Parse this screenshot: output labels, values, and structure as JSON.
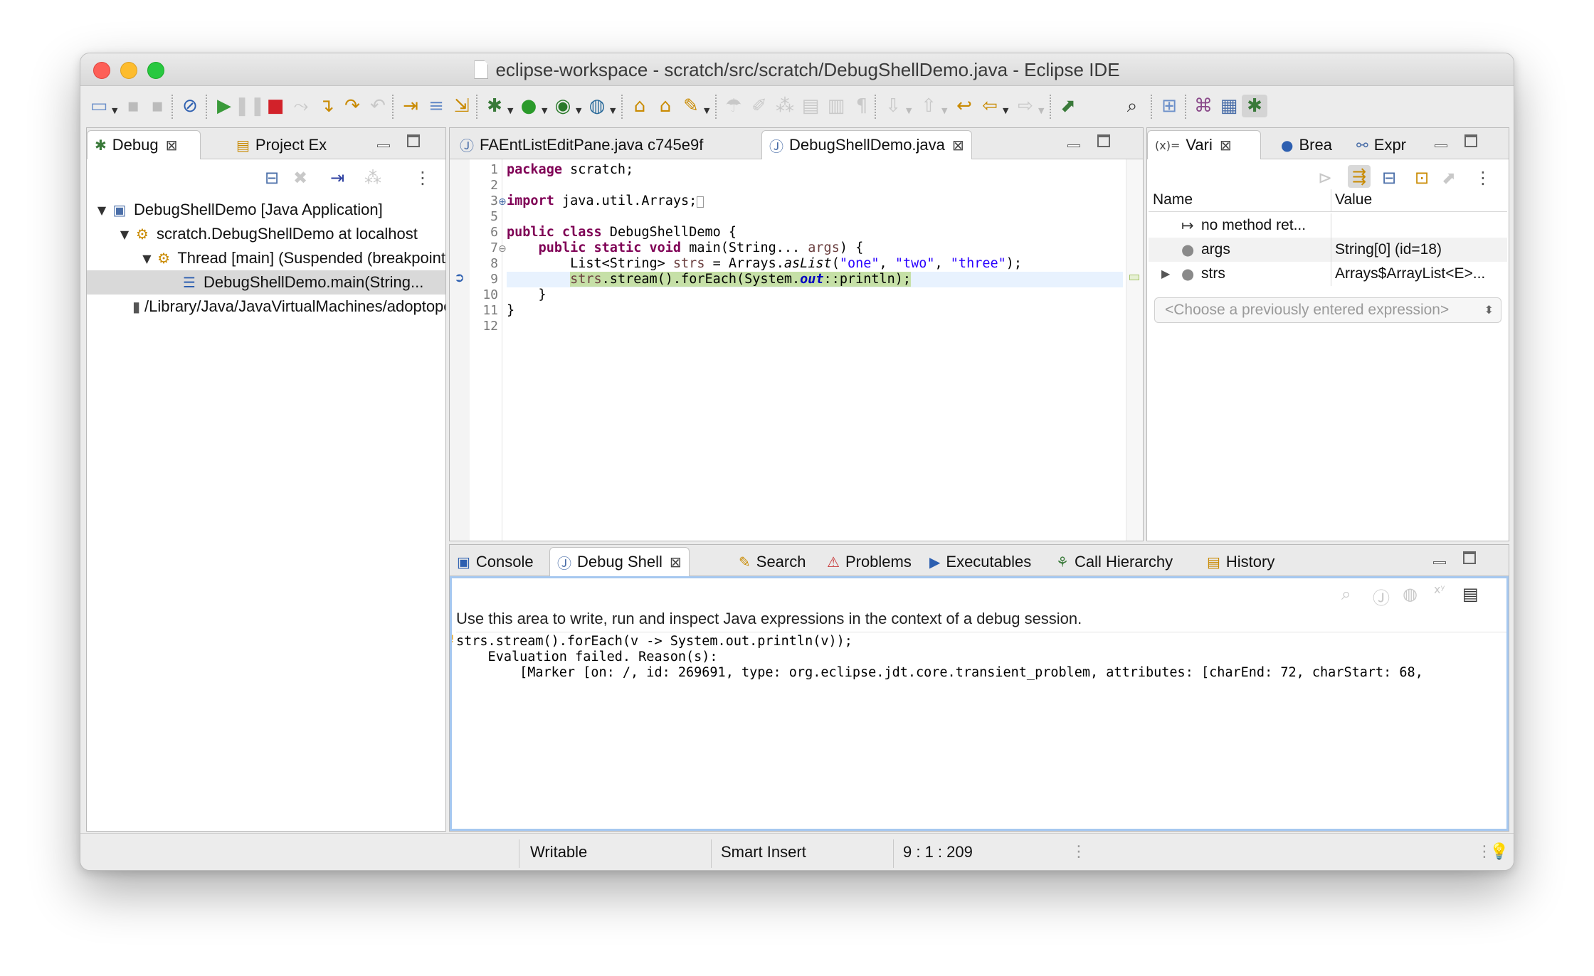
{
  "window": {
    "title": "eclipse-workspace - scratch/src/scratch/DebugShellDemo.java - Eclipse IDE"
  },
  "debug_view": {
    "tabs": [
      {
        "label": "Debug",
        "active": true
      },
      {
        "label": "Project Ex",
        "active": false
      }
    ],
    "tree": [
      {
        "label": "DebugShellDemo [Java Application]",
        "level": 0,
        "icon": "java-app-icon",
        "expanded": true
      },
      {
        "label": "scratch.DebugShellDemo at localhost",
        "level": 1,
        "icon": "debug-target-icon",
        "expanded": true
      },
      {
        "label": "Thread [main] (Suspended (breakpoint",
        "level": 2,
        "icon": "thread-icon",
        "expanded": true
      },
      {
        "label": "DebugShellDemo.main(String...",
        "level": 3,
        "icon": "stack-frame-icon",
        "selected": true
      },
      {
        "label": "/Library/Java/JavaVirtualMachines/adoptopenjdk",
        "level": 1,
        "icon": "jvm-process-icon"
      }
    ]
  },
  "editor": {
    "tabs": [
      {
        "label": "FAEntListEditPane.java c745e9f",
        "active": false
      },
      {
        "label": "DebugShellDemo.java",
        "active": true
      }
    ],
    "line_numbers": [
      "1",
      "2",
      "3",
      "5",
      "6",
      "7",
      "8",
      "9",
      "10",
      "11",
      "12"
    ],
    "current_line": "9"
  },
  "variables_view": {
    "tabs": [
      {
        "label": "Vari",
        "prefix": "(x)=",
        "active": true
      },
      {
        "label": "Brea",
        "active": false
      },
      {
        "label": "Expr",
        "active": false
      }
    ],
    "columns": [
      "Name",
      "Value"
    ],
    "rows": [
      {
        "name": "no method ret...",
        "value": "",
        "icon": "method-return-icon"
      },
      {
        "name": "args",
        "value": "String[0]  (id=18)",
        "icon": "local-variable-icon"
      },
      {
        "name": "strs",
        "value": "Arrays$ArrayList<E>...",
        "icon": "local-variable-icon",
        "expandable": true
      }
    ],
    "expression_placeholder": "<Choose a previously entered expression>"
  },
  "bottom_view": {
    "tabs": [
      {
        "label": "Console",
        "active": false
      },
      {
        "label": "Debug Shell",
        "active": true
      },
      {
        "label": "Search",
        "active": false
      },
      {
        "label": "Problems",
        "active": false
      },
      {
        "label": "Executables",
        "active": false
      },
      {
        "label": "Call Hierarchy",
        "active": false
      },
      {
        "label": "History",
        "active": false
      }
    ],
    "hint": "Use this area to write, run and inspect Java expressions in the context of a debug session.",
    "lines": [
      "strs.stream().forEach(v -> System.out.println(v));",
      "    Evaluation failed. Reason(s):",
      "        [Marker [on: /, id: 269691, type: org.eclipse.jdt.core.transient_problem, attributes: [charEnd: 72, charStart: 68, "
    ]
  },
  "status": {
    "writable": "Writable",
    "insert_mode": "Smart Insert",
    "position": "9 : 1 : 209"
  },
  "colors": {
    "keyword": "#7f0055",
    "string": "#2a00ff",
    "current_line_bg": "#e8f2fe",
    "execution_bg": "#c6e0a7",
    "focus_border": "#a6c8f0"
  }
}
